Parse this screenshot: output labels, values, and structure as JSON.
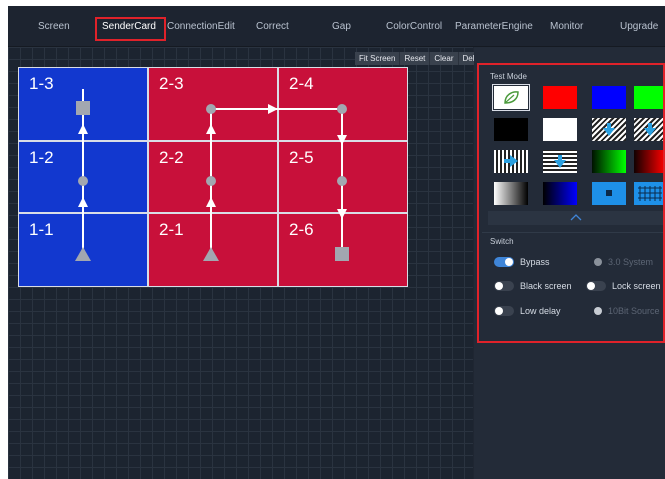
{
  "nav": {
    "tabs": [
      "Screen",
      "SenderCard",
      "ConnectionEdit",
      "Correct",
      "Gap",
      "ColorControl",
      "ParameterEngine",
      "Monitor",
      "Upgrade"
    ],
    "active_tab": "SenderCard"
  },
  "toolbar": {
    "fit": "Fit Screen",
    "reset": "Reset",
    "clear": "Clear",
    "del": "Del"
  },
  "tiles": [
    "1-3",
    "2-3",
    "2-4",
    "1-2",
    "2-2",
    "2-5",
    "1-1",
    "2-1",
    "2-6"
  ],
  "colors": {
    "blue": "#1238cf",
    "red": "#c8103a",
    "accent": "#3f85d8",
    "highlight": "#e0222a"
  },
  "test_mode": {
    "title": "Test Mode",
    "patterns": [
      "leaf-icon",
      "red",
      "blue",
      "green",
      "black",
      "white",
      "diagonal-lines-down",
      "diagonal-lines-down-2",
      "vertical-lines-right",
      "horizontal-lines-down",
      "green-gradient",
      "red-gradient",
      "gray-gradient",
      "blue-gradient",
      "dot-icon",
      "grid-icon"
    ]
  },
  "switch": {
    "title": "Switch",
    "items": [
      {
        "label": "Bypass",
        "on": true,
        "enabled": true
      },
      {
        "label": "3.0 System",
        "on": false,
        "enabled": false
      },
      {
        "label": "Black screen",
        "on": false,
        "enabled": true
      },
      {
        "label": "Lock screen",
        "on": false,
        "enabled": true
      },
      {
        "label": "Low delay",
        "on": false,
        "enabled": true
      },
      {
        "label": "10Bit Source",
        "on": false,
        "enabled": false
      }
    ]
  }
}
